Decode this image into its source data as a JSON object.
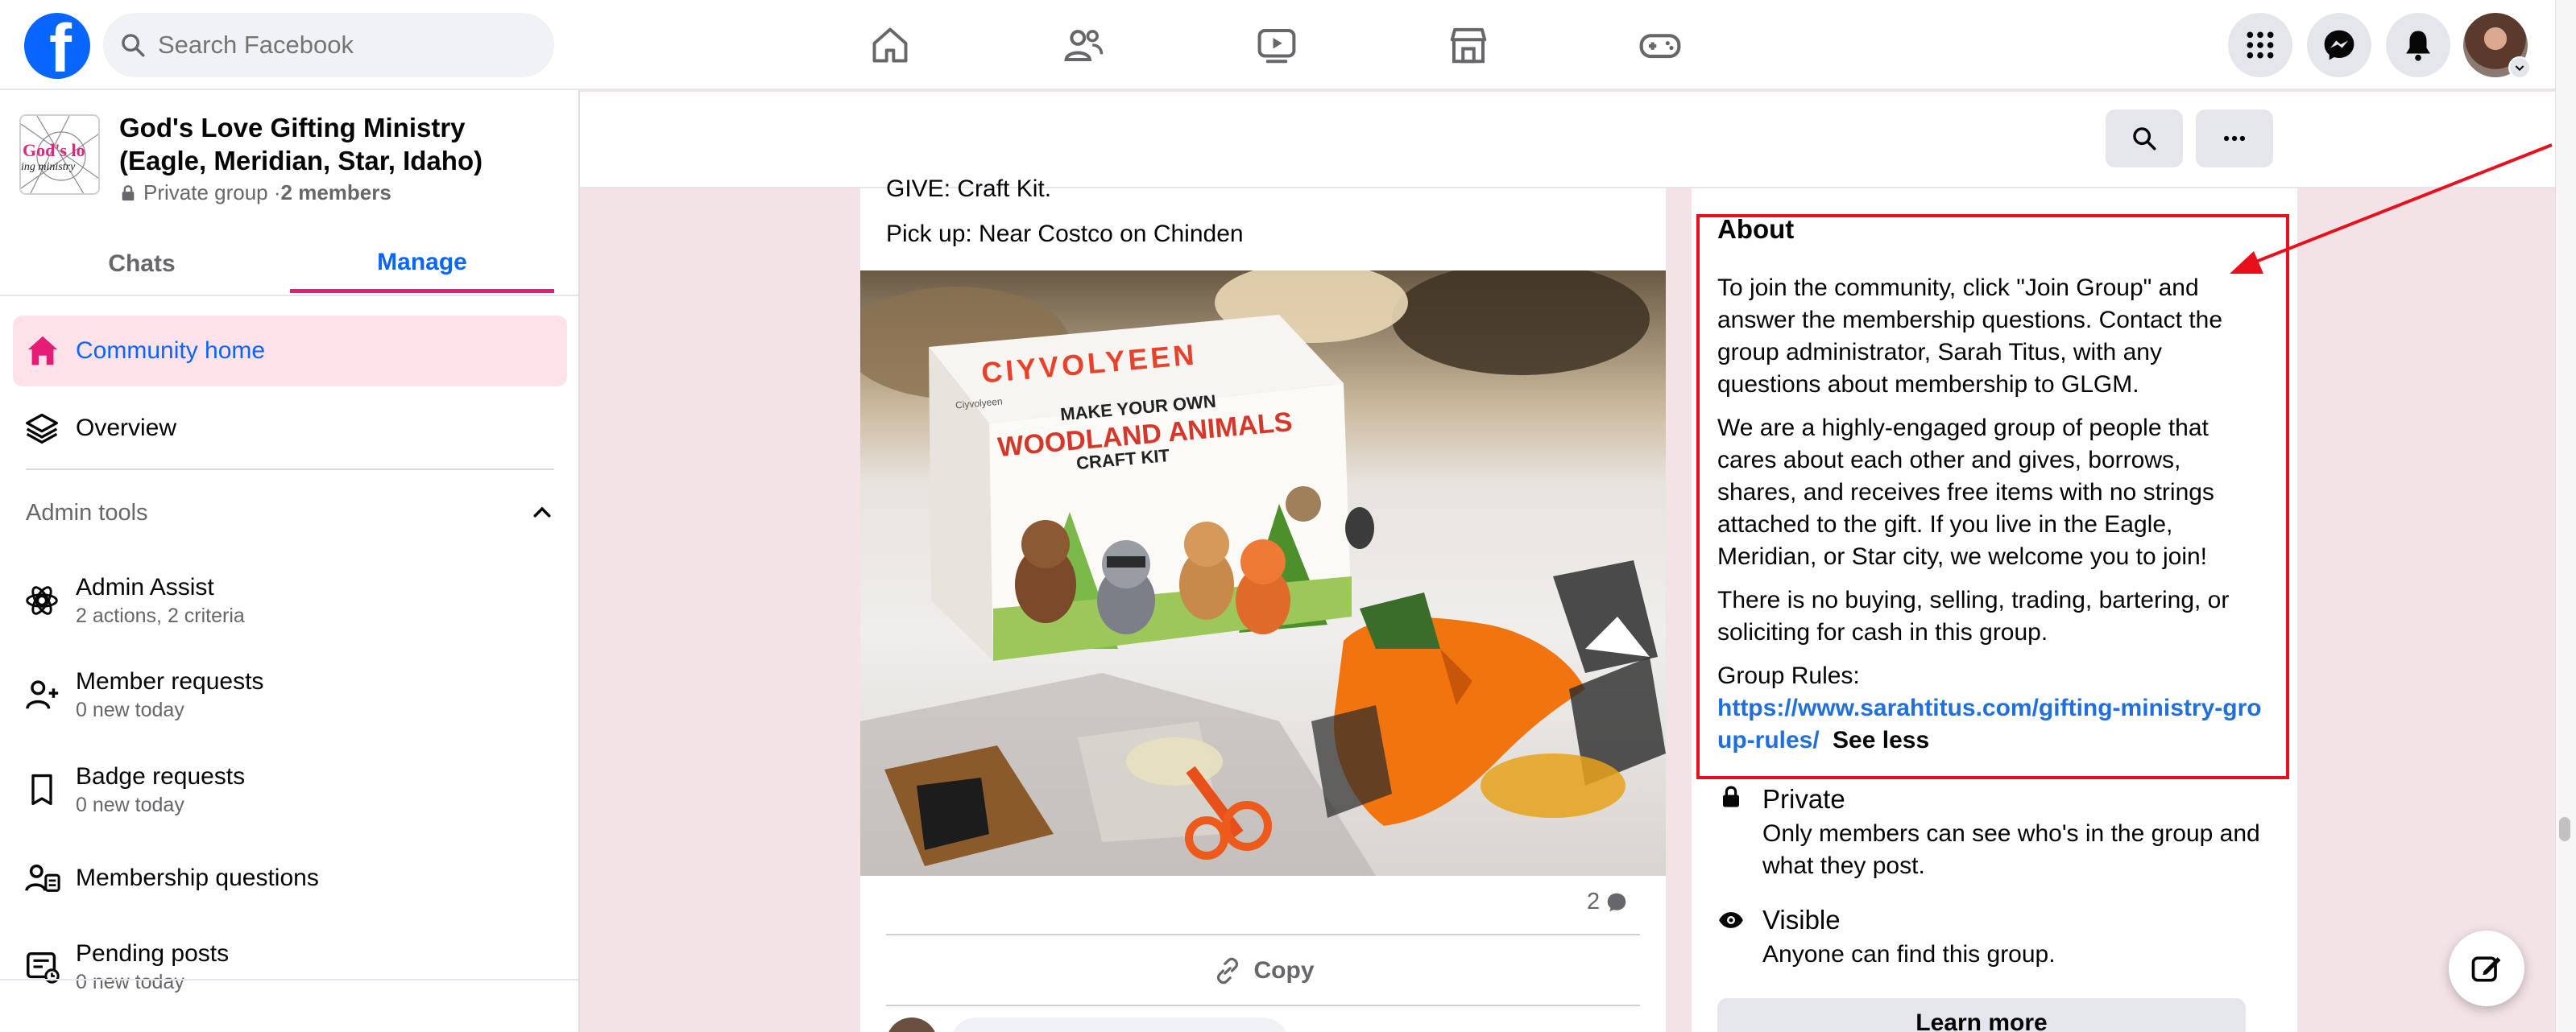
{
  "nav": {
    "search_placeholder": "Search Facebook"
  },
  "group": {
    "name_line1": "God's Love Gifting Ministry",
    "name_line2": "(Eagle, Meridian, Star, Idaho)",
    "privacy": "Private group · ",
    "members": "2 members",
    "logo_text_top": "God's lo",
    "logo_text_bottom": "ing ministry"
  },
  "tabs": {
    "chats": "Chats",
    "manage": "Manage"
  },
  "sidebar": {
    "community_home": "Community home",
    "overview": "Overview",
    "admin_tools": "Admin tools",
    "items": [
      {
        "title": "Admin Assist",
        "sub": "2 actions, 2 criteria"
      },
      {
        "title": "Member requests",
        "sub": "0 new today"
      },
      {
        "title": "Badge requests",
        "sub": "0 new today"
      },
      {
        "title": "Membership questions",
        "sub": ""
      },
      {
        "title": "Pending posts",
        "sub": "0 new today"
      }
    ]
  },
  "post": {
    "line1": "GIVE: Craft Kit.",
    "line2": "Pick up: Near Costco on Chinden",
    "box_brand": "CIYVOLYEEN",
    "box_line1": "MAKE YOUR OWN",
    "box_line2": "WOODLAND ANIMALS",
    "box_line3": "CRAFT KIT",
    "box_small": "Ciyvolyeen",
    "comment_count": "2",
    "copy_label": "Copy"
  },
  "about": {
    "heading": "About",
    "p1": "To join the community, click \"Join Group\" and answer the membership questions. Contact the group administrator, Sarah Titus, with any questions about membership to GLGM.",
    "p2": "We are a highly-engaged group of people that cares about each other and gives, borrows, shares, and receives free items with no strings attached to the gift. If you live in the Eagle, Meridian, or Star city, we welcome you to join!",
    "p3": "There is no buying, selling, trading, bartering, or soliciting for cash in this group.",
    "rules_label": "Group Rules:",
    "rules_link": "https://www.sarahtitus.com/gifting-ministry-group-rules/",
    "see_less": "See less",
    "private_title": "Private",
    "private_desc": "Only members can see who's in the group and what they post.",
    "visible_title": "Visible",
    "visible_desc": "Anyone can find this group.",
    "learn_more": "Learn more"
  },
  "colors": {
    "brand_blue": "#0866ff",
    "accent_pink": "#e41e76",
    "active_bg": "#fde2ea",
    "highlight_red": "#e8101b",
    "main_bg": "#f3e3e6"
  }
}
